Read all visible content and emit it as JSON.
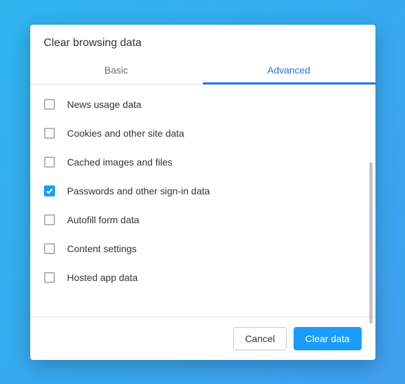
{
  "dialog": {
    "title": "Clear browsing data",
    "tabs": [
      {
        "label": "Basic",
        "active": false
      },
      {
        "label": "Advanced",
        "active": true
      }
    ],
    "items": [
      {
        "label": "News usage data",
        "checked": false
      },
      {
        "label": "Cookies and other site data",
        "checked": false
      },
      {
        "label": "Cached images and files",
        "checked": false
      },
      {
        "label": "Passwords and other sign-in data",
        "checked": true
      },
      {
        "label": "Autofill form data",
        "checked": false
      },
      {
        "label": "Content settings",
        "checked": false
      },
      {
        "label": "Hosted app data",
        "checked": false
      }
    ],
    "buttons": {
      "cancel": "Cancel",
      "clear": "Clear data"
    }
  }
}
